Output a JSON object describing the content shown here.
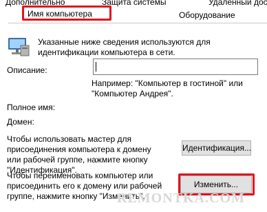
{
  "tabs": {
    "additional": "Дополнительно",
    "protection": "Защита системы",
    "remote": "Удаленный доступ",
    "computer_name": "Имя компьютера",
    "hardware": "Оборудование"
  },
  "info": {
    "text": "Указанные ниже сведения используются для идентификации компьютера в сети.",
    "icon": "computer-network-icon"
  },
  "description": {
    "label": "Описание:",
    "value": "",
    "example": "Например: \"Компьютер в гостиной\" или \"Компьютер Андрея\"."
  },
  "full_name": {
    "label": "Полное имя:"
  },
  "domain": {
    "label": "Домен:"
  },
  "identification": {
    "text": "Чтобы использовать мастер для присоединения компьютера к домену или рабочей группе, нажмите кнопку \"Идентификация\".",
    "button": "Идентификация..."
  },
  "rename": {
    "text": "Чтобы переименовать компьютер или присоединить его к домену или рабочей группе, нажмите кнопку \"Изменить\".",
    "button": "Изменить..."
  },
  "watermark": "REMONTKA.COM",
  "colors": {
    "highlight": "#e0141d",
    "button_bg": "#e1e1e1"
  }
}
